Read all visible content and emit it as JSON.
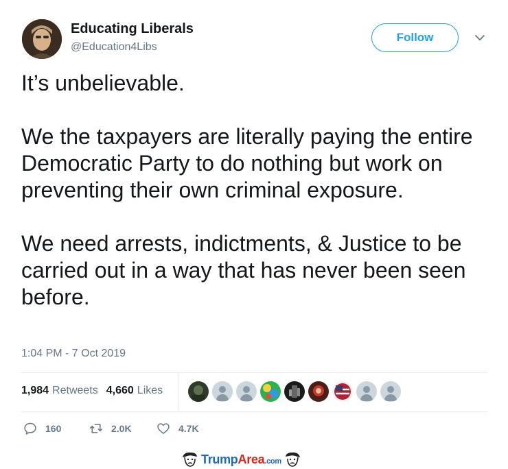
{
  "author": {
    "display_name": "Educating Liberals",
    "handle": "@Education4Libs"
  },
  "follow_label": "Follow",
  "tweet": {
    "paragraphs": [
      "It’s unbelievable.",
      "We the taxpayers are literally paying the entire Democratic Party to do nothing but work on preventing their own criminal exposure.",
      "We need arrests, indictments, & Justice to be carried out in a way that has never been seen before."
    ],
    "timestamp": "1:04 PM - 7 Oct 2019"
  },
  "stats": {
    "retweets_count": "1,984",
    "retweets_label": "Retweets",
    "likes_count": "4,660",
    "likes_label": "Likes"
  },
  "actions": {
    "reply_count": "160",
    "retweet_count": "2.0K",
    "like_count": "4.7K"
  },
  "watermark": {
    "trump": "Trump",
    "area": "Area",
    "com": ".com"
  },
  "colors": {
    "accent": "#1da1f2",
    "muted": "#657786",
    "text": "#14171a"
  }
}
